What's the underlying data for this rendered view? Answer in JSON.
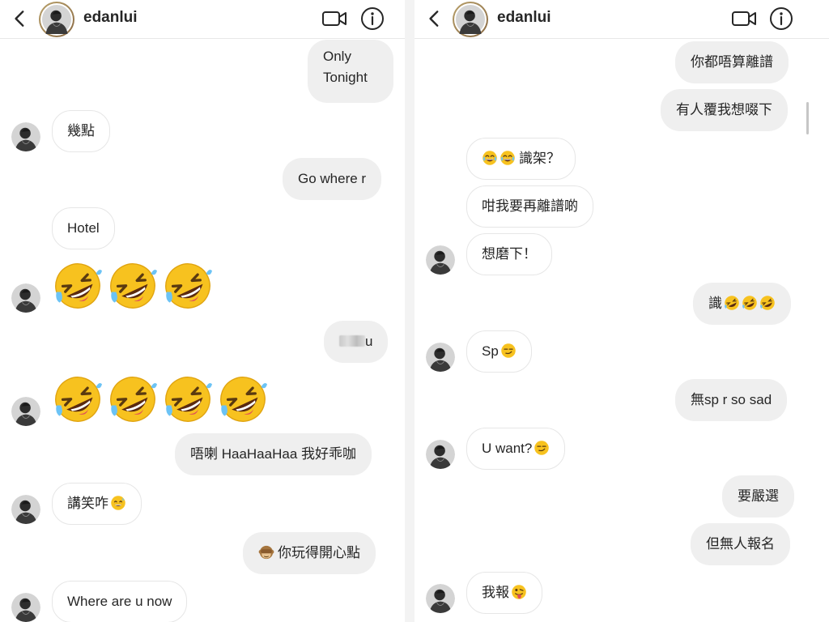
{
  "left": {
    "header": {
      "username": "edanlui"
    },
    "messages": {
      "only_tonight_1": "Only",
      "only_tonight_2": "Tonight",
      "jidim": "幾點",
      "go_where": "Go where r",
      "hotel": "Hotel",
      "diu_suffix": "u",
      "m_lei": "唔喇 HaaHaaHaa 我好乖咖",
      "gong_siu": "講笑咋",
      "nei_wan": "你玩得開心點",
      "where_are_u": "Where are u now"
    }
  },
  "right": {
    "header": {
      "username": "edanlui"
    },
    "messages": {
      "nei_dou": "你都唔算離譜",
      "jau_jan": "有人覆我想啜下",
      "sik_ga": "識架？",
      "gam_ngo": "咁我要再離譜啲",
      "soeng_mo": "想磨下！",
      "sik": "識",
      "sp": "Sp",
      "mou_sp": "無sp r so sad",
      "u_want": "U want?",
      "jiu_jim": "要嚴選",
      "daan_mou": "但無人報名",
      "ngo_bou": "我報"
    }
  },
  "icons": [
    "back-chevron-icon",
    "video-call-icon",
    "info-icon",
    "rofl-emoji-icon",
    "grinning-sweat-emoji-icon",
    "smirk-emoji-icon",
    "see-no-evil-monkey-emoji-icon",
    "tongue-emoji-icon",
    "tears-of-joy-emoji-icon"
  ],
  "colors": {
    "outgoing_bubble": "#efefef",
    "incoming_border": "#e6e6e6",
    "text": "#262626",
    "emoji_yellow": "#f7c21f"
  }
}
